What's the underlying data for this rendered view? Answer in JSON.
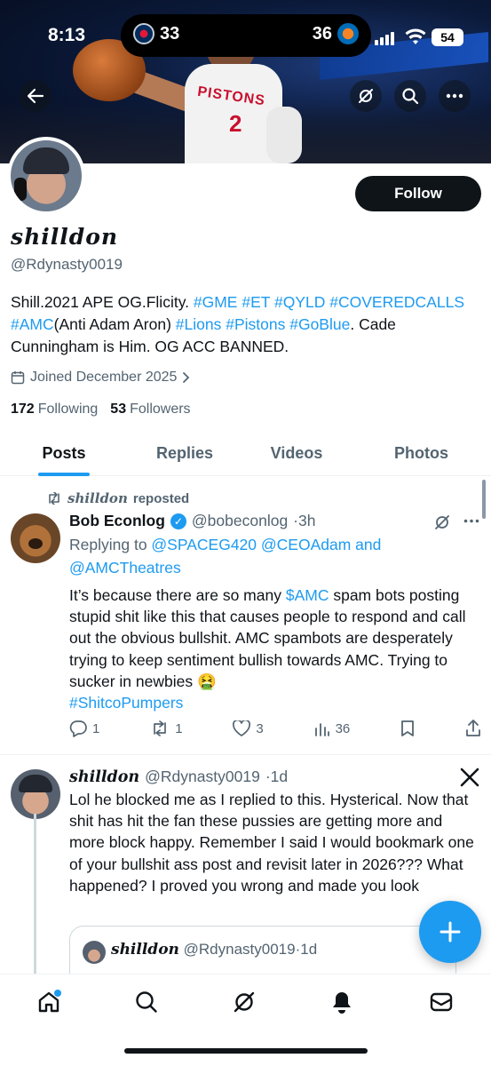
{
  "status_bar": {
    "time": "8:13",
    "away_score": "33",
    "home_score": "36",
    "battery": "54"
  },
  "banner": {
    "jersey_name": "PISTONS",
    "jersey_number": "2"
  },
  "profile": {
    "display_name": "shilldon",
    "handle": "@Rdynasty0019",
    "follow_label": "Follow",
    "bio": {
      "p1": "Shill.2021 APE OG.Flicity. ",
      "t1": "#GME",
      "t2": "#ET",
      "t3": "#QYLD",
      "t4": "#COVEREDCALLS",
      "t5": "#AMC",
      "p2": "(Anti Adam Aron) ",
      "t6": "#Lions",
      "t7": "#Pistons",
      "t8": "#GoBlue",
      "p3": ". Cade Cunningham is Him. OG ACC BANNED."
    },
    "joined": "Joined December 2025",
    "following_count": "172",
    "following_label": "Following",
    "followers_count": "53",
    "followers_label": "Followers"
  },
  "tabs": [
    "Posts",
    "Replies",
    "Videos",
    "Photos"
  ],
  "posts": [
    {
      "repost_by": "shilldon",
      "repost_label": "reposted",
      "author": "Bob Econlog",
      "handle": "@bobeconlog",
      "time": "·3h",
      "replying_prefix": "Replying to ",
      "replying_to_1": "@SPACEG420",
      "replying_to_2": "@CEOAdam",
      "replying_and": " and",
      "replying_to_3": "@AMCTheatres",
      "text_1": "It’s because there are so many ",
      "text_tag_1": "$AMC",
      "text_2": " spam bots posting stupid shit like this that causes people to respond and call out the obvious bullshit. AMC spambots are desperately trying to keep sentiment bullish towards AMC. Trying to sucker in newbies 🤮",
      "text_tag_2": "#ShitcoPumpers",
      "replies": "1",
      "reposts": "1",
      "likes": "3",
      "views": "36"
    },
    {
      "author": "shilldon",
      "handle": "@Rdynasty0019",
      "time": "·1d",
      "text": "Lol he blocked me as I replied to this. Hysterical. Now that shit has hit the fan these pussies are getting more and more block happy. Remember I said I would bookmark one of your bullshit ass post and revisit later in 2026??? What happened? I proved you wrong and made you look",
      "quote_author": "shilldon",
      "quote_handle": "@Rdynasty0019",
      "quote_time": "·1d"
    }
  ],
  "colors": {
    "accent": "#1d9bf0",
    "text": "#0f1419",
    "muted": "#536471"
  },
  "icons": [
    "back-arrow-icon",
    "grok-icon",
    "search-icon",
    "more-icon",
    "calendar-icon",
    "chevron-right-icon",
    "repost-icon",
    "reply-icon",
    "like-icon",
    "views-icon",
    "bookmark-icon",
    "share-icon",
    "x-logo-icon",
    "plus-icon",
    "home-icon",
    "bell-icon",
    "mail-icon"
  ]
}
